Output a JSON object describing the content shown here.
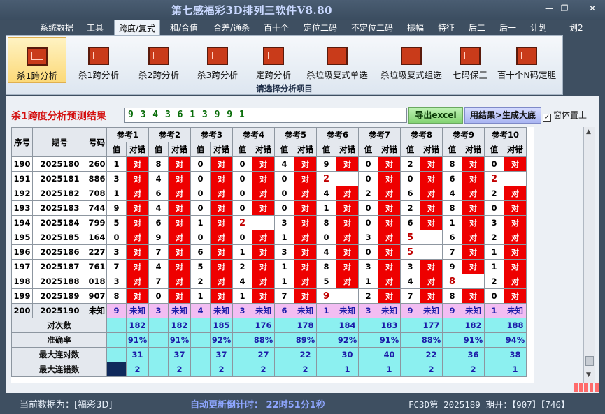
{
  "window": {
    "title": "第七感福彩3D排列三软件V8.80",
    "minimize_glyph": "—",
    "restore_glyph": "❐",
    "close_glyph": "✕"
  },
  "menu": [
    "系统数据",
    "工具",
    "跨度/复式",
    "和/合值",
    "合差/通杀",
    "百十个",
    "定位二码",
    "不定位二码",
    "振幅",
    "特征",
    "后二",
    "后一",
    "计划",
    "划2"
  ],
  "menu_active_index": 2,
  "ribbon": {
    "buttons": [
      "杀1跨分析",
      "杀1跨分析",
      "杀2跨分析",
      "杀3跨分析",
      "定跨分析",
      "杀垃圾复式单选",
      "杀垃圾复式组选",
      "七码保三",
      "百十个N码定胆"
    ],
    "active_index": 0,
    "caption": "请选择分析项目"
  },
  "result": {
    "label": "杀1跨度分析预测结果",
    "value": "9 3 4 3 6 1 3 9 9 1",
    "export_label": "导出excel",
    "dream_label": "用结果>生成大底",
    "topmost_label": "窗体置上",
    "topmost_checked": true
  },
  "table": {
    "col_seq": "序号",
    "col_issue": "期号",
    "col_code": "号码",
    "groups": [
      "参考1",
      "参考2",
      "参考3",
      "参考4",
      "参考5",
      "参考6",
      "参考7",
      "参考8",
      "参考9",
      "参考10"
    ],
    "sub_value": "值",
    "sub_check": "对错",
    "right_text": "对",
    "rows": [
      {
        "seq": "190",
        "issue": "2025180",
        "code": "260",
        "vals": [
          "1",
          "8",
          "0",
          "0",
          "4",
          "9",
          "0",
          "2",
          "8",
          "0"
        ],
        "ok": [
          1,
          1,
          1,
          1,
          1,
          1,
          1,
          1,
          1,
          1
        ]
      },
      {
        "seq": "191",
        "issue": "2025181",
        "code": "886",
        "vals": [
          "3",
          "4",
          "0",
          "0",
          "0",
          "2",
          "0",
          "0",
          "6",
          "2"
        ],
        "ok": [
          1,
          1,
          1,
          1,
          1,
          0,
          1,
          1,
          1,
          0
        ]
      },
      {
        "seq": "192",
        "issue": "2025182",
        "code": "708",
        "vals": [
          "1",
          "6",
          "0",
          "0",
          "0",
          "4",
          "2",
          "6",
          "4",
          "2"
        ],
        "ok": [
          1,
          1,
          1,
          1,
          1,
          1,
          1,
          1,
          1,
          1
        ]
      },
      {
        "seq": "193",
        "issue": "2025183",
        "code": "744",
        "vals": [
          "9",
          "4",
          "0",
          "0",
          "0",
          "1",
          "0",
          "2",
          "8",
          "0"
        ],
        "ok": [
          1,
          1,
          1,
          1,
          1,
          1,
          1,
          1,
          1,
          1
        ]
      },
      {
        "seq": "194",
        "issue": "2025184",
        "code": "799",
        "vals": [
          "5",
          "6",
          "1",
          "2",
          "3",
          "8",
          "0",
          "6",
          "1",
          "3"
        ],
        "ok": [
          1,
          1,
          1,
          0,
          1,
          1,
          1,
          1,
          1,
          1
        ]
      },
      {
        "seq": "195",
        "issue": "2025185",
        "code": "164",
        "vals": [
          "0",
          "9",
          "0",
          "0",
          "1",
          "0",
          "3",
          "5",
          "6",
          "2"
        ],
        "ok": [
          1,
          1,
          1,
          1,
          1,
          1,
          1,
          0,
          1,
          1
        ]
      },
      {
        "seq": "196",
        "issue": "2025186",
        "code": "227",
        "vals": [
          "3",
          "7",
          "6",
          "1",
          "3",
          "4",
          "0",
          "5",
          "7",
          "1"
        ],
        "ok": [
          1,
          1,
          1,
          1,
          1,
          1,
          1,
          0,
          1,
          1
        ]
      },
      {
        "seq": "197",
        "issue": "2025187",
        "code": "761",
        "vals": [
          "7",
          "4",
          "5",
          "2",
          "1",
          "8",
          "3",
          "3",
          "9",
          "1"
        ],
        "ok": [
          1,
          1,
          1,
          1,
          1,
          1,
          1,
          1,
          1,
          1
        ]
      },
      {
        "seq": "198",
        "issue": "2025188",
        "code": "018",
        "vals": [
          "3",
          "7",
          "2",
          "4",
          "1",
          "5",
          "1",
          "4",
          "8",
          "2"
        ],
        "ok": [
          1,
          1,
          1,
          1,
          1,
          1,
          1,
          1,
          0,
          1
        ]
      },
      {
        "seq": "199",
        "issue": "2025189",
        "code": "907",
        "vals": [
          "8",
          "0",
          "1",
          "1",
          "7",
          "9",
          "2",
          "7",
          "8",
          "0"
        ],
        "ok": [
          1,
          1,
          1,
          1,
          1,
          0,
          1,
          1,
          1,
          1
        ]
      }
    ],
    "pending_row": {
      "seq": "200",
      "issue": "2025190",
      "code": "未知",
      "vals": [
        "9",
        "3",
        "4",
        "3",
        "6",
        "1",
        "3",
        "9",
        "9",
        "1"
      ],
      "check": "未知"
    },
    "stats": [
      {
        "label": "对次数",
        "vals": [
          "182",
          "182",
          "185",
          "176",
          "178",
          "184",
          "183",
          "177",
          "182",
          "188"
        ]
      },
      {
        "label": "准确率",
        "vals": [
          "91%",
          "91%",
          "92%",
          "88%",
          "89%",
          "92%",
          "91%",
          "88%",
          "91%",
          "94%"
        ]
      },
      {
        "label": "最大连对数",
        "vals": [
          "31",
          "37",
          "37",
          "27",
          "22",
          "30",
          "40",
          "22",
          "36",
          "38"
        ]
      },
      {
        "label": "最大连错数",
        "vals": [
          "2",
          "2",
          "2",
          "2",
          "2",
          "1",
          "1",
          "2",
          "2",
          "1"
        ]
      }
    ]
  },
  "status": {
    "current": "当前数据为：[福彩3D]",
    "countdown": "自动更新倒计时：  22时51分1秒",
    "issue": "FC3D第 2025189 期开：【907】【746】"
  }
}
